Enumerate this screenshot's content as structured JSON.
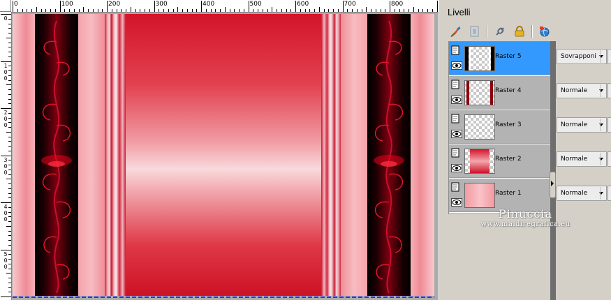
{
  "window": {
    "panel_title": "Livelli"
  },
  "rulers": {
    "top_labels": [
      "0",
      "100",
      "200",
      "300",
      "400",
      "500",
      "600",
      "700",
      "800"
    ],
    "left_labels": [
      [
        "0"
      ],
      [
        "1",
        "0",
        "0"
      ],
      [
        "2",
        "0",
        "0"
      ],
      [
        "3",
        "0",
        "0"
      ],
      [
        "4",
        "0",
        "0"
      ],
      [
        "5",
        "0",
        "0"
      ]
    ]
  },
  "toolbar": {
    "icons": [
      "brush-icon",
      "mask-icon",
      "link-icon",
      "lock-icon",
      "globe-icon"
    ]
  },
  "layers": [
    {
      "name": "Raster 5",
      "blend": "Sovrapponi",
      "selected": true,
      "thumb": "frame"
    },
    {
      "name": "Raster 4",
      "blend": "Normale",
      "selected": false,
      "thumb": "sides"
    },
    {
      "name": "Raster 3",
      "blend": "Normale",
      "selected": false,
      "thumb": "empty"
    },
    {
      "name": "Raster 2",
      "blend": "Normale",
      "selected": false,
      "thumb": "red"
    },
    {
      "name": "Raster 1",
      "blend": "Normale",
      "selected": false,
      "thumb": "pink"
    }
  ],
  "watermark": {
    "name": "Pinuccia",
    "url": "www.maidiregrafica.eu"
  },
  "colors": {
    "selection": "#3399ff",
    "layer_row": "#b3b3b3",
    "red_main": "#d81e2e",
    "pink": "#f39aa2"
  }
}
